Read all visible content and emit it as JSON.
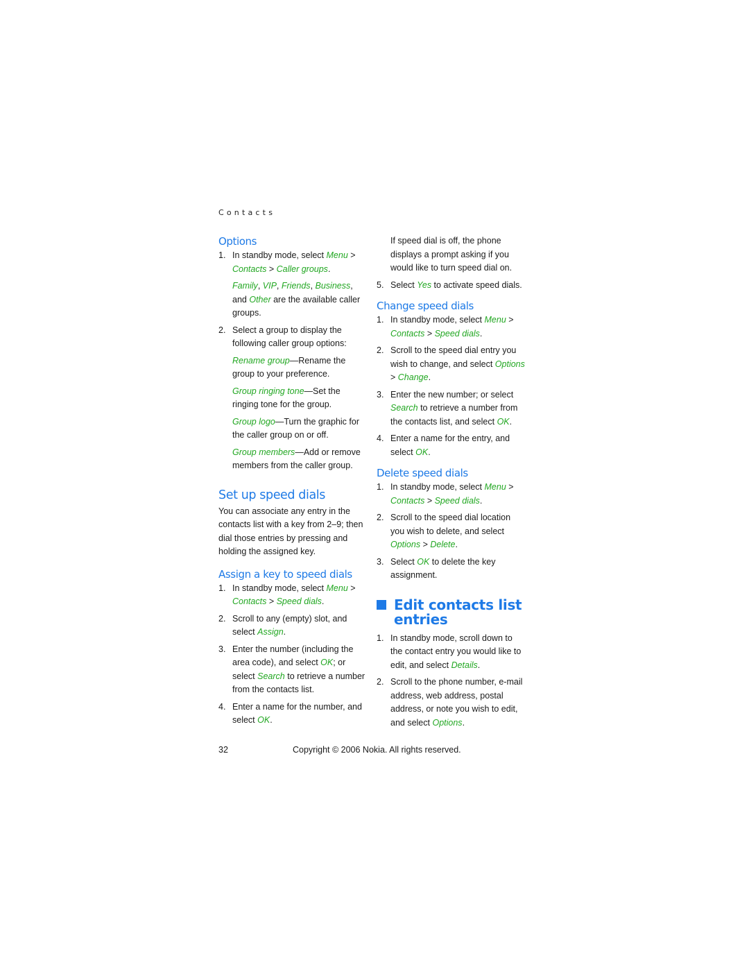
{
  "running_head": "Contacts",
  "left": {
    "options": {
      "heading": "Options",
      "step1": {
        "num": "1.",
        "t1": "In standby mode, select ",
        "menu": "Menu",
        "gt1": " > ",
        "contacts": "Contacts",
        "gt2": " > ",
        "caller_groups": "Caller groups",
        "end": "."
      },
      "groups_note": {
        "family": "Family",
        "c1": ", ",
        "vip": "VIP",
        "c2": ", ",
        "friends": "Friends",
        "c3": ", ",
        "business": "Business",
        "and": ", and ",
        "other": "Other",
        "rest": " are the available caller groups."
      },
      "step2": {
        "num": "2.",
        "text": "Select a group to display the following caller group options:"
      },
      "opts": [
        {
          "name": "Rename group",
          "desc": "—Rename the group to your preference."
        },
        {
          "name": "Group ringing tone",
          "desc": "—Set the ringing tone for the group."
        },
        {
          "name": "Group logo",
          "desc": "—Turn the graphic for the caller group on or off."
        },
        {
          "name": "Group members",
          "desc": "—Add or remove members from the caller group."
        }
      ]
    },
    "setup": {
      "heading": "Set up speed dials",
      "intro": "You can associate any entry in the contacts list with a key from 2–9; then dial those entries by pressing and holding the assigned key."
    },
    "assign": {
      "heading": "Assign a key to speed dials",
      "step1": {
        "num": "1.",
        "t1": "In standby mode, select ",
        "menu": "Menu",
        "gt1": " > ",
        "contacts": "Contacts",
        "gt2": " > ",
        "speed": "Speed dials",
        "end": "."
      },
      "step2": {
        "num": "2.",
        "t1": "Scroll to any (empty) slot, and select ",
        "assign": "Assign",
        "end": "."
      },
      "step3": {
        "num": "3.",
        "t1": "Enter the number (including the area code), and select ",
        "ok": "OK",
        "t2": "; or select ",
        "search": "Search",
        "t3": " to retrieve a number from the contacts list."
      },
      "step4": {
        "num": "4.",
        "t1": "Enter a name for the number, and select ",
        "ok": "OK",
        "end": "."
      }
    }
  },
  "right": {
    "cont_note": "If speed dial is off, the phone displays a prompt asking if you would like to turn speed dial on.",
    "step5": {
      "num": "5.",
      "t1": "Select ",
      "yes": "Yes",
      "t2": " to activate speed dials."
    },
    "change": {
      "heading": "Change speed dials",
      "step1": {
        "num": "1.",
        "t1": "In standby mode, select ",
        "menu": "Menu",
        "gt1": " > ",
        "contacts": "Contacts",
        "gt2": " > ",
        "speed": "Speed dials",
        "end": "."
      },
      "step2": {
        "num": "2.",
        "t1": "Scroll to the speed dial entry you wish to change, and select ",
        "options": "Options",
        "gt": " > ",
        "change": "Change",
        "end": "."
      },
      "step3": {
        "num": "3.",
        "t1": "Enter the new number; or select ",
        "search": "Search",
        "t2": " to retrieve a number from the contacts list, and select ",
        "ok": "OK",
        "end": "."
      },
      "step4": {
        "num": "4.",
        "t1": "Enter a name for the entry, and select ",
        "ok": "OK",
        "end": "."
      }
    },
    "delete": {
      "heading": "Delete speed dials",
      "step1": {
        "num": "1.",
        "t1": "In standby mode, select ",
        "menu": "Menu",
        "gt1": " > ",
        "contacts": "Contacts",
        "gt2": " > ",
        "speed": "Speed dials",
        "end": "."
      },
      "step2": {
        "num": "2.",
        "t1": "Scroll to the speed dial location you wish to delete, and select ",
        "options": "Options",
        "gt": " > ",
        "del": "Delete",
        "end": "."
      },
      "step3": {
        "num": "3.",
        "t1": "Select ",
        "ok": "OK",
        "t2": " to delete the key assignment."
      }
    },
    "edit": {
      "heading": "Edit contacts list entries",
      "step1": {
        "num": "1.",
        "t1": "In standby mode, scroll down to the contact entry you would like to edit, and select ",
        "details": "Details",
        "end": "."
      },
      "step2": {
        "num": "2.",
        "t1": "Scroll to the phone number, e-mail address, web address, postal address, or note you wish to edit, and select ",
        "options": "Options",
        "end": "."
      }
    }
  },
  "footer": {
    "page_number": "32",
    "copyright": "Copyright © 2006 Nokia. All rights reserved."
  },
  "colors": {
    "heading_blue": "#1e7ae6",
    "link_green": "#22a722"
  }
}
